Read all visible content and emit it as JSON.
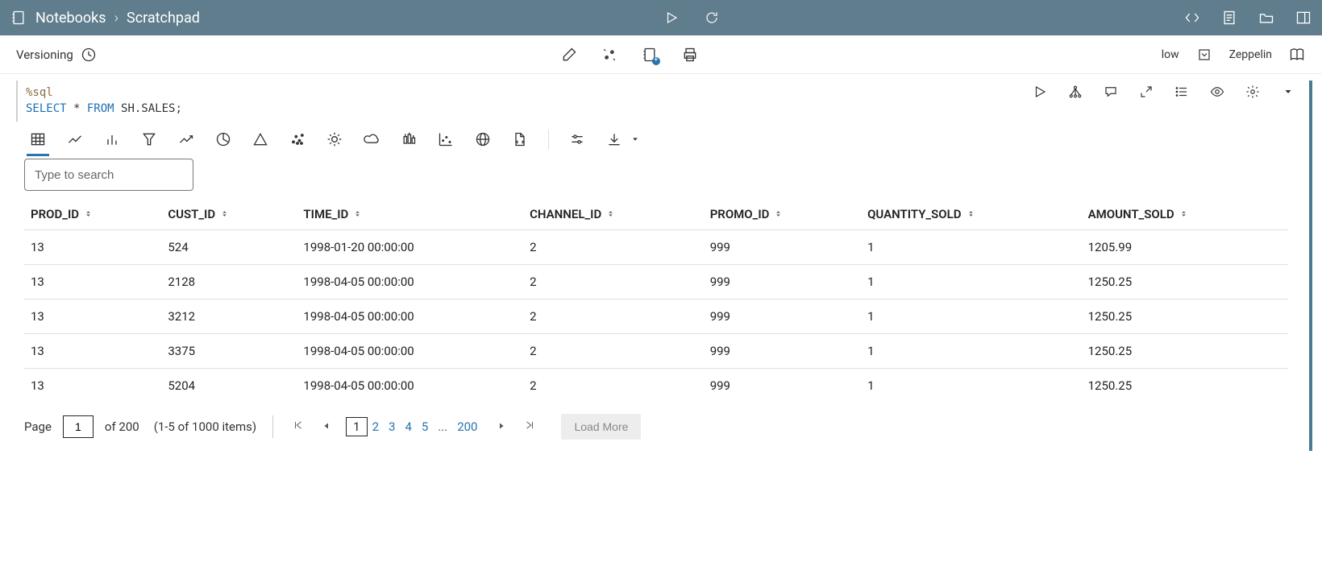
{
  "header": {
    "breadcrumb_root": "Notebooks",
    "breadcrumb_current": "Scratchpad"
  },
  "subbar": {
    "versioning_label": "Versioning",
    "right_low": "low",
    "right_engine": "Zeppelin"
  },
  "code": {
    "magic": "%sql",
    "query_kw1": "SELECT",
    "query_star": " * ",
    "query_kw2": "FROM",
    "query_rest": " SH.SALES;"
  },
  "search": {
    "placeholder": "Type to search"
  },
  "columns": [
    "PROD_ID",
    "CUST_ID",
    "TIME_ID",
    "CHANNEL_ID",
    "PROMO_ID",
    "QUANTITY_SOLD",
    "AMOUNT_SOLD"
  ],
  "rows": [
    {
      "PROD_ID": "13",
      "CUST_ID": "524",
      "TIME_ID": "1998-01-20 00:00:00",
      "CHANNEL_ID": "2",
      "PROMO_ID": "999",
      "QUANTITY_SOLD": "1",
      "AMOUNT_SOLD": "1205.99"
    },
    {
      "PROD_ID": "13",
      "CUST_ID": "2128",
      "TIME_ID": "1998-04-05 00:00:00",
      "CHANNEL_ID": "2",
      "PROMO_ID": "999",
      "QUANTITY_SOLD": "1",
      "AMOUNT_SOLD": "1250.25"
    },
    {
      "PROD_ID": "13",
      "CUST_ID": "3212",
      "TIME_ID": "1998-04-05 00:00:00",
      "CHANNEL_ID": "2",
      "PROMO_ID": "999",
      "QUANTITY_SOLD": "1",
      "AMOUNT_SOLD": "1250.25"
    },
    {
      "PROD_ID": "13",
      "CUST_ID": "3375",
      "TIME_ID": "1998-04-05 00:00:00",
      "CHANNEL_ID": "2",
      "PROMO_ID": "999",
      "QUANTITY_SOLD": "1",
      "AMOUNT_SOLD": "1250.25"
    },
    {
      "PROD_ID": "13",
      "CUST_ID": "5204",
      "TIME_ID": "1998-04-05 00:00:00",
      "CHANNEL_ID": "2",
      "PROMO_ID": "999",
      "QUANTITY_SOLD": "1",
      "AMOUNT_SOLD": "1250.25"
    }
  ],
  "pager": {
    "page_label": "Page",
    "page_input": "1",
    "of_label": "of 200",
    "items_label": "(1-5 of 1000 items)",
    "pages": [
      "1",
      "2",
      "3",
      "4",
      "5",
      "...",
      "200"
    ],
    "load_more": "Load More"
  }
}
